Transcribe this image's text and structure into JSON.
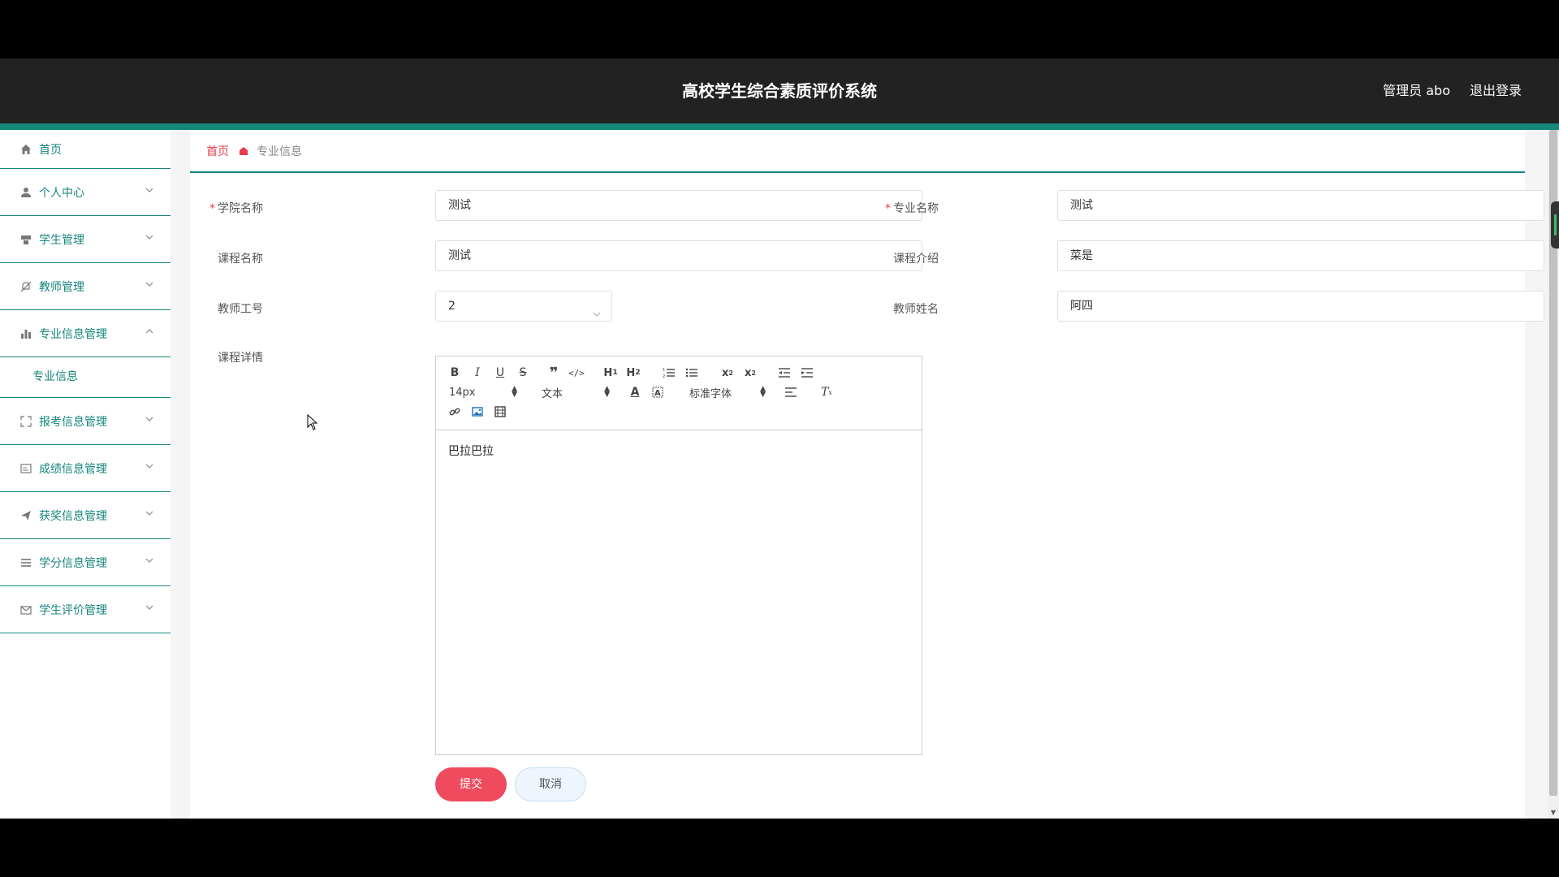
{
  "header": {
    "title": "高校学生综合素质评价系统",
    "user_label": "管理员 abo",
    "logout_label": "退出登录"
  },
  "sidebar": {
    "items": [
      {
        "label": "首页",
        "icon": "home-icon"
      },
      {
        "label": "个人中心",
        "icon": "user-icon"
      },
      {
        "label": "学生管理",
        "icon": "student-icon"
      },
      {
        "label": "教师管理",
        "icon": "bell-off-icon"
      },
      {
        "label": "专业信息管理",
        "icon": "bar-chart-icon",
        "expanded": true,
        "children": [
          {
            "label": "专业信息"
          }
        ]
      },
      {
        "label": "报考信息管理",
        "icon": "fullscreen-icon"
      },
      {
        "label": "成绩信息管理",
        "icon": "card-icon"
      },
      {
        "label": "获奖信息管理",
        "icon": "paper-plane-icon"
      },
      {
        "label": "学分信息管理",
        "icon": "list-icon"
      },
      {
        "label": "学生评价管理",
        "icon": "mail-icon"
      }
    ]
  },
  "breadcrumb": {
    "home": "首页",
    "current": "专业信息"
  },
  "form": {
    "college_label": "学院名称",
    "college_value": "测试",
    "major_label": "专业名称",
    "major_value": "测试",
    "course_label": "课程名称",
    "course_value": "测试",
    "intro_label": "课程介绍",
    "intro_value": "菜是",
    "teacher_id_label": "教师工号",
    "teacher_id_value": "2",
    "teacher_name_label": "教师姓名",
    "teacher_name_value": "阿四",
    "detail_label": "课程详情"
  },
  "editor": {
    "size_value": "14px",
    "header_value": "文本",
    "font_value": "标准字体",
    "content": "巴拉巴拉"
  },
  "buttons": {
    "submit": "提交",
    "cancel": "取消"
  },
  "colors": {
    "accent": "#15867c",
    "primary_red": "#f04a5e",
    "header_bg": "#222222"
  }
}
